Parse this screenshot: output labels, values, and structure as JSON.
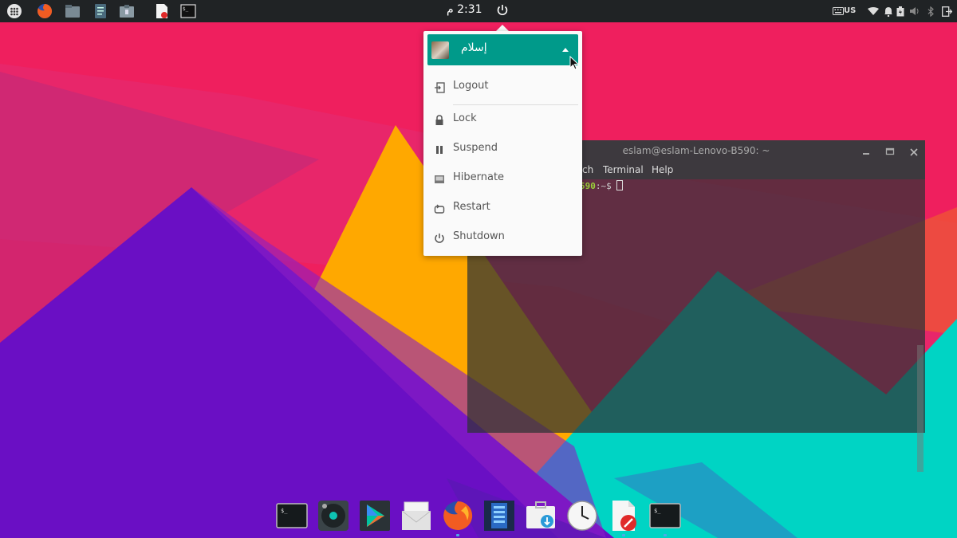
{
  "top_panel": {
    "clock": "2:31 م",
    "keyboard_layout": "US",
    "launchers": [
      "app-grid-icon",
      "firefox-icon",
      "file-manager-icon",
      "text-editor-icon",
      "archive-manager-icon",
      "document-viewer-icon",
      "terminal-icon"
    ],
    "indicators": [
      "keyboard-icon",
      "wifi-icon",
      "notification-bell-icon",
      "battery-icon",
      "volume-icon",
      "bluetooth-icon",
      "logout-arrow-icon"
    ]
  },
  "power_menu": {
    "user_name": "إسلام",
    "items": [
      {
        "label": "Logout",
        "icon": "logout-icon"
      },
      {
        "label": "Lock",
        "icon": "lock-icon"
      },
      {
        "label": "Suspend",
        "icon": "pause-icon"
      },
      {
        "label": "Hibernate",
        "icon": "hibernate-icon"
      },
      {
        "label": "Restart",
        "icon": "restart-icon"
      },
      {
        "label": "Shutdown",
        "icon": "power-icon"
      }
    ]
  },
  "terminal": {
    "title": "eslam@eslam-Lenovo-B590: ~",
    "menu": [
      "ch",
      "Terminal",
      "Help"
    ],
    "prompt_host": "590",
    "prompt_path": ":~$"
  },
  "dock": {
    "items": [
      "terminal-icon",
      "music-player-icon",
      "play-store-icon",
      "mail-icon",
      "firefox-icon",
      "disk-utility-icon",
      "software-center-icon",
      "clock-icon",
      "document-viewer-icon",
      "terminal-icon"
    ]
  },
  "colors": {
    "panel": "#202325",
    "menu_accent": "#009a8a",
    "wallpaper_pink": "#ef1f5e",
    "wallpaper_purple": "#6a0fc4",
    "wallpaper_orange": "#ffa800",
    "wallpaper_teal": "#00d4c4"
  }
}
